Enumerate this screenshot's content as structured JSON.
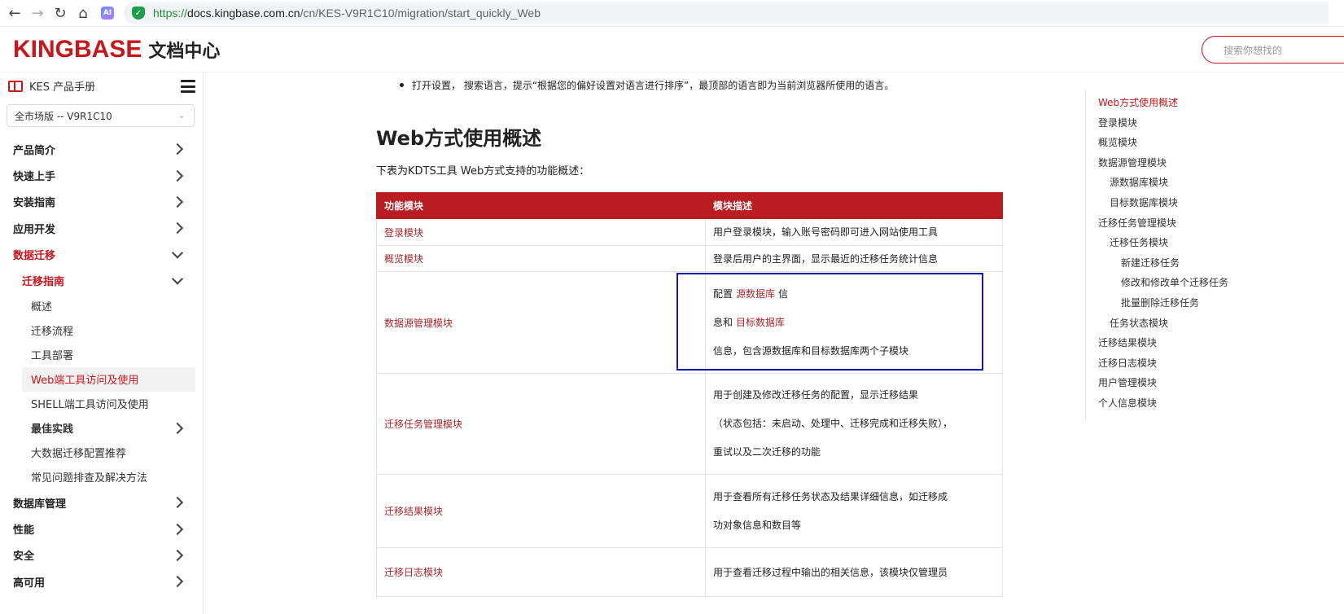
{
  "browser": {
    "url_scheme": "https://",
    "url_host": "docs.kingbase.com.cn",
    "url_path": "/cn/KES-V9R1C10/migration/start_quickly_Web",
    "ai_label": "AI"
  },
  "header": {
    "logo": "KINGBASE",
    "subtitle": "文档中心",
    "search_placeholder": "搜索你想找的"
  },
  "sidebar": {
    "manual_label": "KES 产品手册",
    "version": "全市场版 -- V9R1C10",
    "items": [
      {
        "label": "产品简介",
        "level": 1,
        "chevron": "right"
      },
      {
        "label": "快速上手",
        "level": 1,
        "chevron": "right"
      },
      {
        "label": "安装指南",
        "level": 1,
        "chevron": "right"
      },
      {
        "label": "应用开发",
        "level": 1,
        "chevron": "right"
      },
      {
        "label": "数据迁移",
        "level": 1,
        "chevron": "down",
        "active": true
      },
      {
        "label": "迁移指南",
        "level": 2,
        "chevron": "down",
        "active": true
      },
      {
        "label": "概述",
        "level": 3
      },
      {
        "label": "迁移流程",
        "level": 3
      },
      {
        "label": "工具部署",
        "level": 3
      },
      {
        "label": "Web端工具访问及使用",
        "level": 3,
        "selected": true
      },
      {
        "label": "SHELL端工具访问及使用",
        "level": 3
      },
      {
        "label": "最佳实践",
        "level": 3,
        "chevron": "right",
        "bold": true
      },
      {
        "label": "大数据迁移配置推荐",
        "level": 3
      },
      {
        "label": "常见问题排查及解决方法",
        "level": 3
      },
      {
        "label": "数据库管理",
        "level": 1,
        "chevron": "right"
      },
      {
        "label": "性能",
        "level": 1,
        "chevron": "right"
      },
      {
        "label": "安全",
        "level": 1,
        "chevron": "right"
      },
      {
        "label": "高可用",
        "level": 1,
        "chevron": "right"
      }
    ]
  },
  "content": {
    "bullet": "打开设置， 搜索语言，提示“根据您的偏好设置对语言进行排序”，最顶部的语言即为当前浏览器所使用的语言。",
    "heading": "Web方式使用概述",
    "intro": "下表为KDTS工具 Web方式支持的功能概述：",
    "table": {
      "headers": [
        "功能模块",
        "模块描述"
      ],
      "rows": [
        {
          "module": "登录模块",
          "desc": [
            "用户登录模块，输入账号密码即可进入网站使用工具"
          ]
        },
        {
          "module": "概览模块",
          "desc": [
            "登录后用户的主界面，显示最近的迁移任务统计信息"
          ]
        },
        {
          "module": "数据源管理模块",
          "desc_rich": [
            {
              "pre": "配置",
              "link": "源数据库",
              "post": "信"
            },
            {
              "pre": "息和",
              "link": "目标数据库",
              "post": ""
            },
            {
              "pre": "信息，包含源数据库和目标数据库两个子模块",
              "link": "",
              "post": ""
            }
          ]
        },
        {
          "module": "迁移任务管理模块",
          "desc": [
            "用于创建及修改迁移任务的配置，显示迁移结果",
            "（状态包括：未启动、处理中、迁移完成和迁移失败），",
            "重试以及二次迁移的功能"
          ]
        },
        {
          "module": "迁移结果模块",
          "desc": [
            "用于查看所有迁移任务状态及结果详细信息，如迁移成",
            "功对象信息和数目等"
          ]
        },
        {
          "module": "迁移日志模块",
          "desc": [
            "用于查看迁移过程中输出的相关信息，该模块仅管理员"
          ]
        }
      ]
    }
  },
  "toc": [
    {
      "label": "Web方式使用概述",
      "indent": 0,
      "active": true
    },
    {
      "label": "登录模块",
      "indent": 0
    },
    {
      "label": "概览模块",
      "indent": 0
    },
    {
      "label": "数据源管理模块",
      "indent": 0
    },
    {
      "label": "源数据库模块",
      "indent": 1
    },
    {
      "label": "目标数据库模块",
      "indent": 1
    },
    {
      "label": "迁移任务管理模块",
      "indent": 0
    },
    {
      "label": "迁移任务模块",
      "indent": 1
    },
    {
      "label": "新建迁移任务",
      "indent": 2
    },
    {
      "label": "修改和修改单个迁移任务",
      "indent": 2
    },
    {
      "label": "批量删除迁移任务",
      "indent": 2
    },
    {
      "label": "任务状态模块",
      "indent": 1
    },
    {
      "label": "迁移结果模块",
      "indent": 0
    },
    {
      "label": "迁移日志模块",
      "indent": 0
    },
    {
      "label": "用户管理模块",
      "indent": 0
    },
    {
      "label": "个人信息模块",
      "indent": 0
    }
  ],
  "colors": {
    "brand_red": "#c8161d",
    "table_header": "#b91c21",
    "highlight_box": "#1414b4"
  }
}
